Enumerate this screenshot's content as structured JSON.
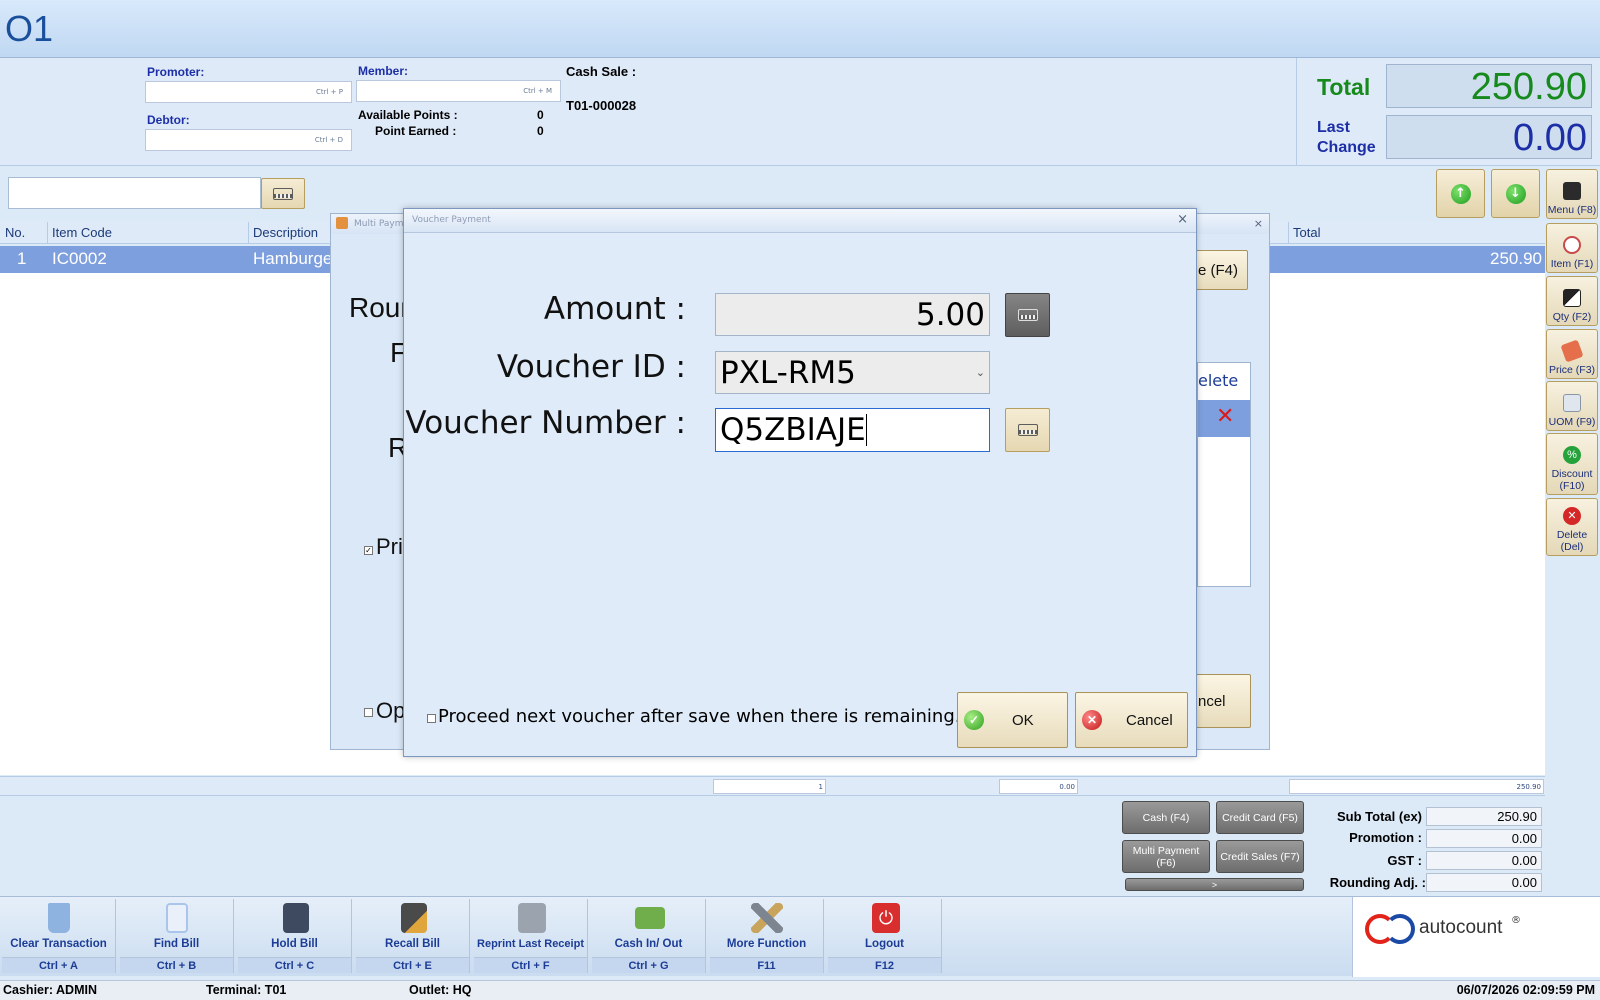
{
  "app": {
    "title": "O1"
  },
  "info": {
    "promoter_label": "Promoter:",
    "promoter_hint": "Ctrl + P",
    "debtor_label": "Debtor:",
    "debtor_hint": "Ctrl + D",
    "member_label": "Member:",
    "member_hint": "Ctrl + M",
    "available_points_label": "Available Points :",
    "available_points_value": "0",
    "point_earned_label": "Point Earned :",
    "point_earned_value": "0",
    "cash_sale_label": "Cash Sale :",
    "doc_no": "T01-000028"
  },
  "totals_panel": {
    "total_label": "Total",
    "total_value": "250.90",
    "last_label": "Last",
    "change_label": "Change",
    "change_value": "0.00"
  },
  "side_buttons": [
    {
      "label": "Menu (F8)"
    },
    {
      "label": "Item (F1)"
    },
    {
      "label": "Qty (F2)"
    },
    {
      "label": "Price (F3)"
    },
    {
      "label": "UOM (F9)"
    },
    {
      "label": "Discount (F10)"
    },
    {
      "label": "Delete (Del)"
    }
  ],
  "grid": {
    "headers": {
      "no": "No.",
      "item_code": "Item Code",
      "description": "Description",
      "total": "Total"
    },
    "rows": [
      {
        "no": "1",
        "item_code": "IC0002",
        "description": "Hamburger",
        "total": "250.90"
      }
    ]
  },
  "multi_payment": {
    "title": "Multi Payment",
    "round_text": "Roun",
    "f_text": "F",
    "r_text": "R",
    "print_text": "Pri",
    "open_text": "Op",
    "f4_btn": "e (F4)",
    "delete_header": "elete",
    "cancel_btn": "ncel"
  },
  "voucher_dialog": {
    "title": "Voucher Payment",
    "amount_label": "Amount :",
    "amount_value": "5.00",
    "voucher_id_label": "Voucher ID :",
    "voucher_id_value": "PXL-RM5",
    "voucher_number_label": "Voucher Number :",
    "voucher_number_value": "Q5ZBIAJE",
    "proceed_text": "Proceed next voucher after save when there is remaining.",
    "ok_label": "OK",
    "cancel_label": "Cancel"
  },
  "summary_row": {
    "qty": "1",
    "discount": "0.00",
    "total": "250.90"
  },
  "payment_buttons": {
    "cash": "Cash (F4)",
    "credit_card": "Credit Card (F5)",
    "multi_payment": "Multi Payment (F6)",
    "credit_sales": "Credit Sales (F7)",
    "more": ">"
  },
  "bill_totals": {
    "sub_total_label": "Sub Total (ex)",
    "sub_total_value": "250.90",
    "promotion_label": "Promotion :",
    "promotion_value": "0.00",
    "gst_label": "GST :",
    "gst_value": "0.00",
    "rounding_label": "Rounding Adj. :",
    "rounding_value": "0.00"
  },
  "toolbar": [
    {
      "label": "Clear Transaction",
      "key": "Ctrl + A",
      "icon": "trash-icon",
      "color": "#8fb3e0"
    },
    {
      "label": "Find Bill",
      "key": "Ctrl + B",
      "icon": "find-bill-icon",
      "color": "#a9c6ea"
    },
    {
      "label": "Hold Bill",
      "key": "Ctrl + C",
      "icon": "save-icon",
      "color": "#3e4a5f"
    },
    {
      "label": "Recall Bill",
      "key": "Ctrl + E",
      "icon": "recall-icon",
      "color": "#4a4a4a"
    },
    {
      "label": "Reprint Last Receipt",
      "key": "Ctrl + F",
      "icon": "printer-icon",
      "color": "#9aa3ae"
    },
    {
      "label": "Cash In/ Out",
      "key": "Ctrl + G",
      "icon": "cash-icon",
      "color": "#6fae4a"
    },
    {
      "label": "More Function",
      "key": "F11",
      "icon": "tools-icon",
      "color": "#7d8591"
    },
    {
      "label": "Logout",
      "key": "F12",
      "icon": "power-icon",
      "color": "#d92e2e"
    }
  ],
  "logo": {
    "brand": "autocount",
    "mark": "®"
  },
  "status": {
    "cashier": "Cashier: ADMIN",
    "terminal": "Terminal: T01",
    "outlet": "Outlet: HQ",
    "datetime": "06/07/2026 02:09:59 PM"
  },
  "colors": {
    "selected_row": "#7e9fde",
    "total_green": "#178a1d",
    "accent_blue": "#1c2fa6"
  }
}
